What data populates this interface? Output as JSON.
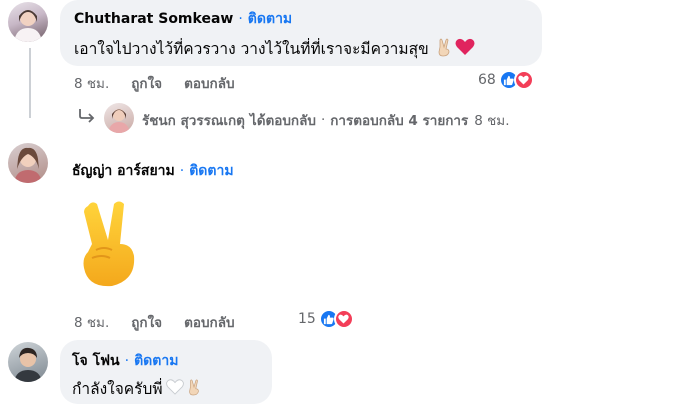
{
  "comments": [
    {
      "author": "Chutharat Somkeaw",
      "separator": "·",
      "follow": "ติดตาม",
      "text": "เอาใจไปวางไว้ที่ควรวาง วางไว้ในที่ที่เราจะมีความสุข",
      "time": "8 ชม.",
      "like_action": "ถูกใจ",
      "reply_action": "ตอบกลับ",
      "reaction_count": "68"
    },
    {
      "author": "ธัญญ่า อาร์สยาม",
      "separator": "·",
      "follow": "ติดตาม",
      "time": "8 ชม.",
      "like_action": "ถูกใจ",
      "reply_action": "ตอบกลับ",
      "reaction_count": "15"
    },
    {
      "author": "โจ โฟน",
      "separator": "·",
      "follow": "ติดตาม",
      "text": "กำลังใจครับพี่"
    }
  ],
  "reply_summary": {
    "name": "รัชนก สุวรรณเกตุ",
    "action": "ได้ตอบกลับ",
    "separator": "·",
    "count_text": "การตอบกลับ 4 รายการ",
    "time": "8 ชม."
  },
  "icons": [
    "victory-hand-emoji",
    "red-heart-emoji",
    "white-heart-emoji",
    "like-reaction-icon",
    "love-reaction-icon",
    "reply-arrow-icon"
  ],
  "colors": {
    "link": "#1877f2",
    "bubble": "#f0f2f5",
    "meta": "#65676b",
    "like": "#1877f2",
    "love": "#f33e58"
  }
}
